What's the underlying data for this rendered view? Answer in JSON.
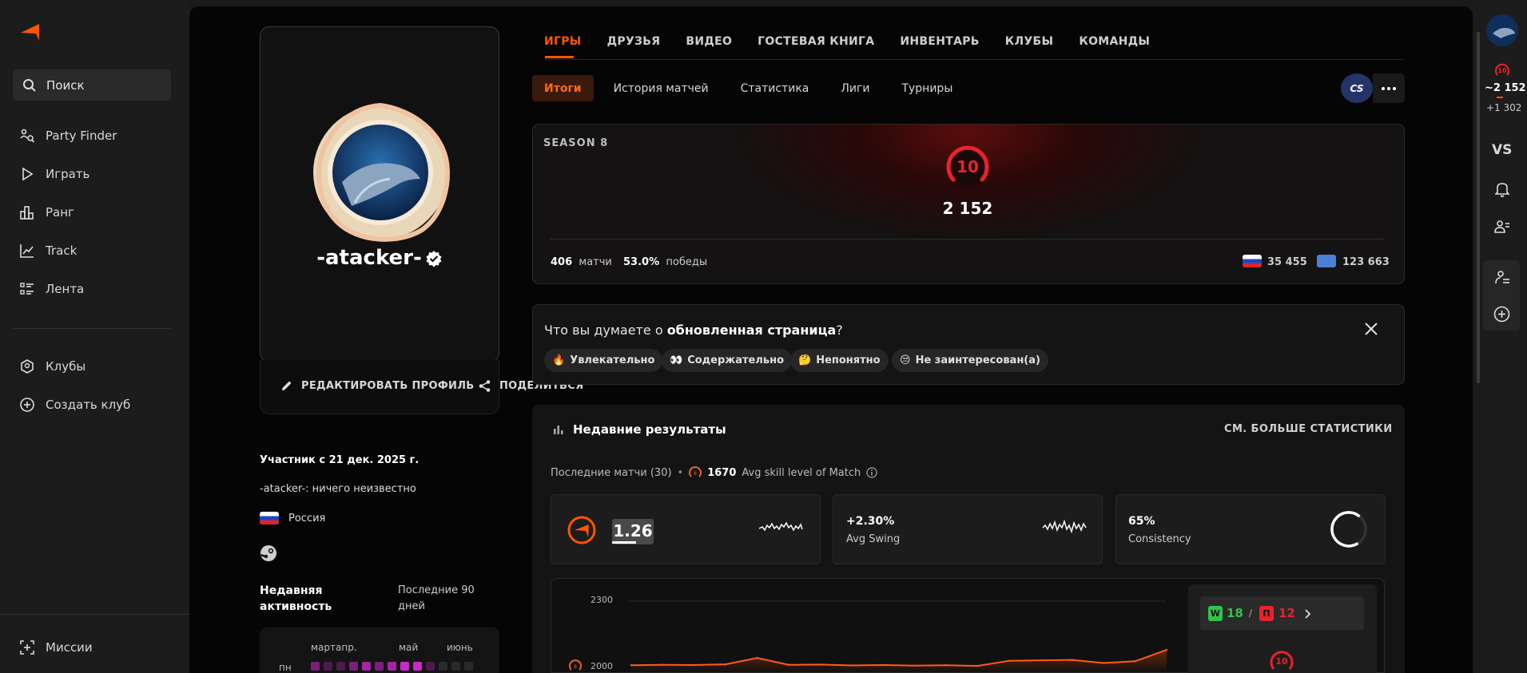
{
  "sidebar": {
    "search_label": "Поиск",
    "items": [
      {
        "label": "Party Finder"
      },
      {
        "label": "Играть"
      },
      {
        "label": "Ранг"
      },
      {
        "label": "Track"
      },
      {
        "label": "Лента"
      },
      {
        "label": "Клубы"
      },
      {
        "label": "Создать клуб"
      },
      {
        "label": "Миссии"
      }
    ]
  },
  "profile": {
    "username": "-atacker-",
    "edit_label": "РЕДАКТИРОВАТЬ ПРОФИЛЬ",
    "share_label": "ПОДЕЛИТЬСЯ",
    "member_since": "Участник с 21 дек. 2025 г.",
    "bio": "-atacker-: ничего неизвестно",
    "country": "Россия",
    "activity_title": "Недавняя активность",
    "activity_range": "Последние 90 дней",
    "activity_months": [
      "мартапр.",
      "май",
      "июнь"
    ],
    "activity_day": "пн",
    "activity_cells": [
      2,
      1,
      1,
      2,
      3,
      2,
      3,
      4,
      4,
      1,
      0,
      0,
      0
    ]
  },
  "tabs": [
    "ИГРЫ",
    "ДРУЗЬЯ",
    "ВИДЕО",
    "ГОСТЕВАЯ КНИГА",
    "ИНВЕНТАРЬ",
    "КЛУБЫ",
    "КОМАНДЫ"
  ],
  "subtabs": [
    "Итоги",
    "История матчей",
    "Статистика",
    "Лиги",
    "Турниры"
  ],
  "game_badge": "CS",
  "season": {
    "label": "SEASON 8",
    "level": "10",
    "elo": "2 152",
    "matches": "406",
    "matches_label": "матчи",
    "winrate": "53.0%",
    "winrate_label": "победы",
    "country_rank": "35 455",
    "region_rank": "123 663"
  },
  "feedback": {
    "question_prefix": "Что вы думаете о ",
    "question_bold": "обновленная страница",
    "question_suffix": "?",
    "chips": [
      {
        "emoji": "🔥",
        "label": "Увлекательно"
      },
      {
        "emoji": "👀",
        "label": "Содержательно"
      },
      {
        "emoji": "🤔",
        "label": "Непонятно"
      },
      {
        "emoji": "😒",
        "label": "Не заинтересован(а)"
      }
    ]
  },
  "recent": {
    "title": "Недавние результаты",
    "more_label": "СМ. БОЛЬШЕ СТАТИСТИКИ",
    "last_matches": "Последние матчи (30)",
    "avg_skill_value": "1670",
    "avg_skill_label": "Avg skill level of Match",
    "kd_value": "1.26",
    "swing_value": "+2.30%",
    "swing_label": "Avg Swing",
    "consistency_value": "65%",
    "consistency_label": "Consistency",
    "wins": "18",
    "losses": "12",
    "win_letter": "W",
    "loss_letter": "П",
    "chart_level": "10"
  },
  "chart_data": {
    "type": "area",
    "yticks": [
      "2300",
      "2000"
    ],
    "ylim": [
      1950,
      2310
    ],
    "values": [
      2010,
      2012,
      2011,
      2014,
      2043,
      2012,
      2013,
      2009,
      2011,
      2008,
      2010,
      2007,
      2030,
      2032,
      2034,
      2020,
      2028,
      2079
    ]
  },
  "rail": {
    "level": "10",
    "elo": "~2 152",
    "gain": "+1 302",
    "vs": "VS"
  },
  "colors": {
    "accent": "#ff5500",
    "level_red": "#e8232b",
    "win": "#31c44a",
    "loss": "#e8232b"
  }
}
